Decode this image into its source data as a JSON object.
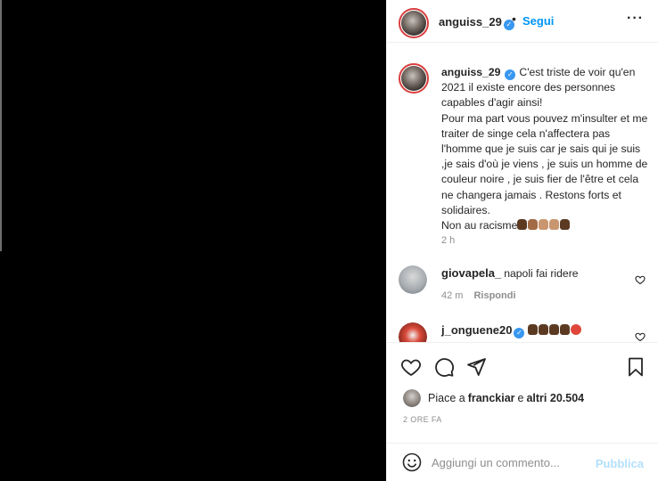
{
  "post": {
    "author": "anguiss_29",
    "follow_label": "Segui",
    "header_separator": "•",
    "more_icon": "more-horizontal-icon",
    "caption": {
      "username": "anguiss_29",
      "text_line1": "C'est triste de voir qu'en 2021 il existe encore des personnes capables d'agir ainsi!",
      "text_line2": "Pour ma part vous pouvez m'insulter et me traiter de singe cela n'affectera pas l'homme que je suis car je sais qui je suis ,je sais d'où je viens , je suis un homme de couleur noire , je suis fier de l'être et cela ne changera jamais . Restons forts et solidaires.",
      "text_line3": "Non au racisme",
      "emoji_icons": [
        "raised-fist-dark-icon",
        "raised-fist-medium-icon",
        "raised-fist-light-icon",
        "raised-fist-light-icon",
        "raised-fist-dark-icon"
      ],
      "time": "2 h"
    },
    "comments": [
      {
        "username": "giovapela_",
        "text": "napoli fai ridere",
        "verified": false,
        "time": "42 m",
        "reply_label": "Rispondi"
      },
      {
        "username": "j_onguene20",
        "text": "",
        "verified": true,
        "emoji_icons": [
          "raised-fist-dark-icon",
          "raised-fist-dark-icon",
          "raised-fist-dark-icon",
          "raised-fist-dark-icon",
          "angry-face-icon"
        ]
      }
    ],
    "likes": {
      "prefix": "Piace a",
      "user": "franckiar",
      "connector": "e",
      "others": "altri 20.504"
    },
    "posted_time": "2 ORE FA",
    "comment_box": {
      "placeholder": "Aggiungi un commento...",
      "publish_label": "Pubblica"
    }
  },
  "colors": {
    "accent_blue": "#0095f6",
    "verified_blue": "#3897f0",
    "publish_disabled": "#b2dffc",
    "muted_text": "#8e8e8e",
    "media_background": "#000000"
  }
}
